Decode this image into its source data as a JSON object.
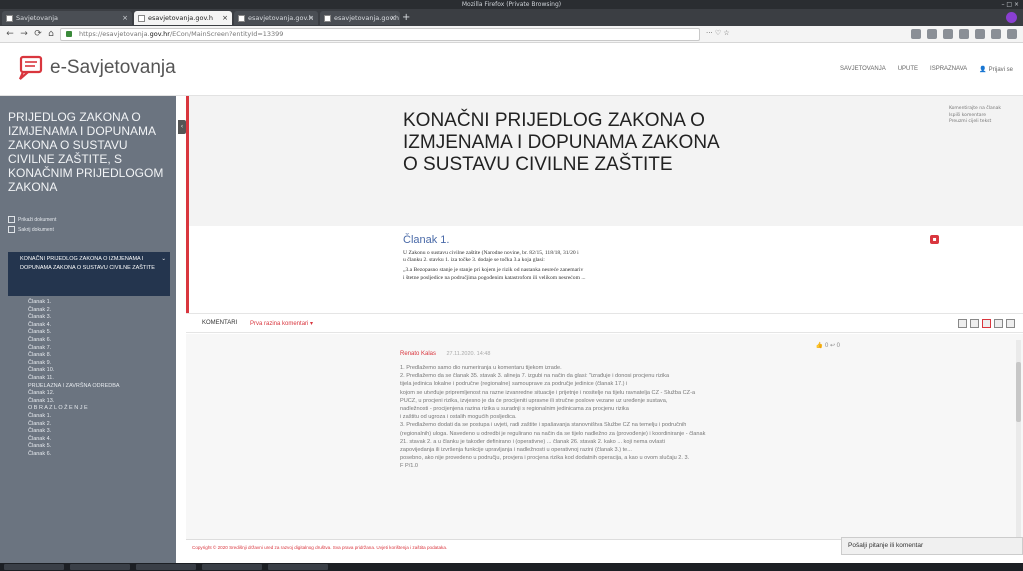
{
  "browser": {
    "window_title": "Mozilla Firefox (Private Browsing)",
    "tabs": [
      {
        "label": "Savjetovanja"
      },
      {
        "label": "esavjetovanja.gov.h"
      },
      {
        "label": "esavjetovanja.gov.h"
      },
      {
        "label": "esavjetovanja.gov.h"
      }
    ],
    "url_prefix": "https://esavjetovanja.",
    "url_domain": "gov.hr",
    "url_suffix": "/ECon/MainScreen?entityId=13399"
  },
  "site": {
    "logo_text": "e-Savjetovanja",
    "nav": [
      "SAVJETOVANJA",
      "UPUTE",
      "ISPRAZNAVA"
    ],
    "user_label": "Prijavi se"
  },
  "sidebar": {
    "title": "PRIJEDLOG ZAKONA O IZMJENAMA I DOPUNAMA ZAKONA O SUSTAVU CIVILNE ZAŠTITE, S KONAČNIM PRIJEDLOGOM ZAKONA",
    "checks": [
      "Prikaži dokument",
      "Sakrij dokument"
    ],
    "active_item": "KONAČNI PRIJEDLOG ZAKONA O IZMJENAMA I DOPUNAMA ZAKONA O SUSTAVU CIVILNE ZAŠTITE",
    "items": [
      "Članak 1.",
      "Članak 2.",
      "Članak 3.",
      "Članak 4.",
      "Članak 5.",
      "Članak 6.",
      "Članak 7.",
      "Članak 8.",
      "Članak 9.",
      "Članak 10.",
      "Članak 11.",
      "PRIJELAZNA I ZAVRŠNA ODREDBA",
      "Članak 12.",
      "Članak 13.",
      "O B R A Z L O Ž E N J E",
      "Članak 1.",
      "Članak 2.",
      "Članak 3.",
      "Članak 4.",
      "Članak 5.",
      "Članak 6."
    ]
  },
  "hero": {
    "title": "KONAČNI PRIJEDLOG ZAKONA O IZMJENAMA I DOPUNAMA ZAKONA O SUSTAVU CIVILNE ZAŠTITE",
    "links": [
      "Komentirajte na članak",
      "Ispiši komentare",
      "Preuzmi cijeli tekst"
    ]
  },
  "document": {
    "heading": "Članak 1.",
    "lines": [
      "U Zakonu o sustavu civilne zaštite (Narodne novine, br. 82/15, 118/18, 31/20 i",
      "u članku 2. stavku 1. iza točke 3. dodaje se točka 3.a koja glasi:",
      "„3.a Bezopasno stanje je stanje pri kojem je rizik od nastanka nesreće zanemariv",
      "i štetne posljedice na područjima pogođenim katastrofom ili velikom nesrećom ..."
    ]
  },
  "comments_bar": {
    "label": "KOMENTARI",
    "link": "Prva razina komentari ▾"
  },
  "comment": {
    "author": "Renato Kalas",
    "date": "27.11.2020. 14:48",
    "likes": "0",
    "replies": "0",
    "body": [
      "1. Predlažemo samo dio numeriranja u komentaru tijekom izrade.",
      "2. Predlažemo da se članak 35. stavak 3. alineja 7. izgubi na način da glasi: \"izrađuje i donosi procjenu rizika",
      "tijela jedinica lokalne i područne (regionalne) samouprave za područje jedinice (članak 17.) i",
      "kojom se utvrđuje pripremljenost na razne izvanredne situacije i prijetnje i nositelje na tijelu ravnatelja CZ - Služba CZ-a",
      "PUCZ, u procjeni rizika, izvjesno je da će procijeniti upravne ili stručne poslove vezane uz uređenje sustava,",
      "nadležnosti - procijenjena razina rizika u suradnji s regionalnim jedinicama za procjenu rizika",
      "i zaštitu od ugroza i ostalih mogućih posljedica.",
      "3. Predlažemo dodati da se postupa i uvjeti, radi zaštite i spašavanja stanovništva Službe CZ na temelju i područnih",
      "(regionalnih) uloga. Navedeno u odredbi je regulirano na način da se tijelo nadležno za (provođenje) i koordiniranje - članak",
      "21. stavak 2. a u članku je također definirano i (operativne) ... članak 26. stavak 2. kako ... koji nema ovlasti",
      "zapovijedanja ili izvršenja funkcije upravljanja i nadležnosti u operativnoj razini (članak 3.) te...",
      "posebno, ako nije provedeno u području, provjera i procjena rizika kod dodatnih operacija, a kao u ovom slučaju 2. 3.",
      "F P/1.0"
    ]
  },
  "footer": {
    "text": "Copyright © 2020 Središnji državni ured za razvoj digitalnog društva. Sva prava pridržana. Uvjeti korištenja i zaštita podataka."
  },
  "chat": {
    "label": "Pošalji pitanje ili komentar"
  },
  "colors": {
    "accent": "#d9363e",
    "sidebar_bg": "#6b7480",
    "sidebar_active": "#24354e"
  }
}
